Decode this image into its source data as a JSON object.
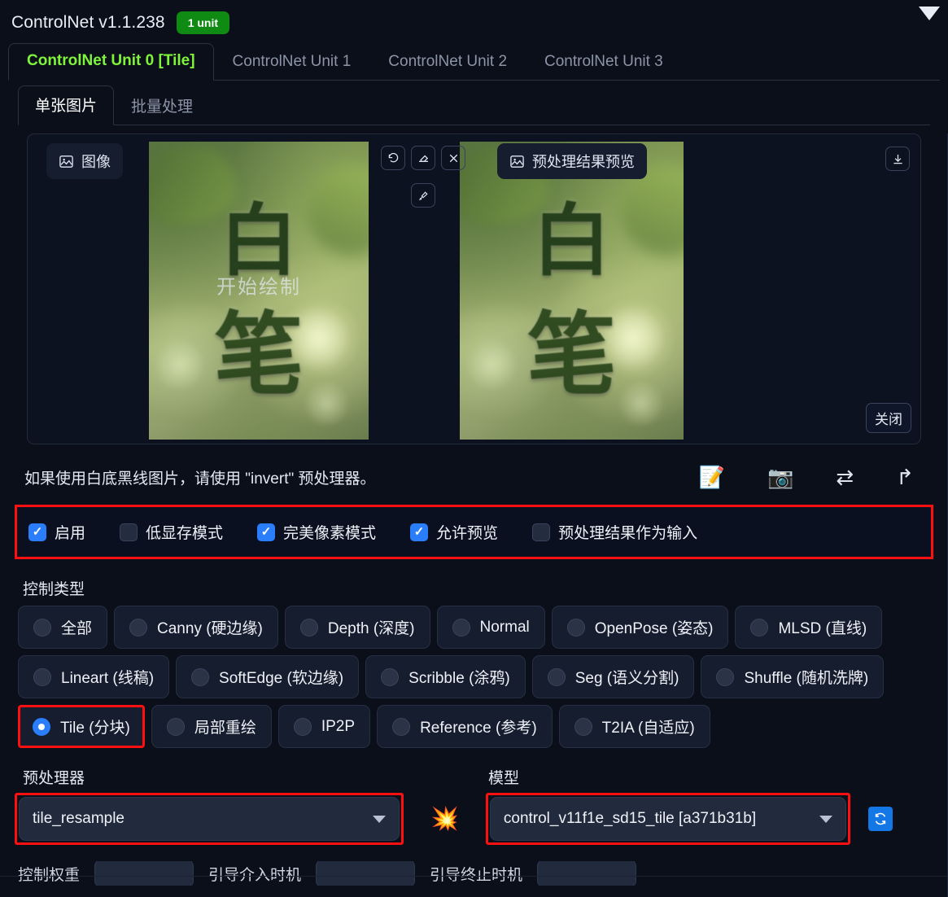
{
  "header": {
    "title": "ControlNet v1.1.238",
    "unit_badge": "1 unit",
    "collapse_icon": "caret-down-icon"
  },
  "unit_tabs": [
    {
      "label": "ControlNet Unit 0 [Tile]",
      "active": true
    },
    {
      "label": "ControlNet Unit 1",
      "active": false
    },
    {
      "label": "ControlNet Unit 2",
      "active": false
    },
    {
      "label": "ControlNet Unit 3",
      "active": false
    }
  ],
  "sub_tabs": [
    {
      "label": "单张图片",
      "active": true
    },
    {
      "label": "批量处理",
      "active": false
    }
  ],
  "image_panel": {
    "input_chip": "图像",
    "preview_chip": "预处理结果预览",
    "draw_overlay": "开始绘制",
    "close_button": "关闭",
    "tools": [
      {
        "name": "undo-icon",
        "glyph": "↺"
      },
      {
        "name": "eraser-icon",
        "glyph": "◇"
      },
      {
        "name": "clear-icon",
        "glyph": "✕"
      },
      {
        "name": "brush-icon",
        "glyph": "✎"
      }
    ],
    "download_icon": "↓",
    "image_glyph_top": "白",
    "image_glyph_bottom": "笔"
  },
  "hint": {
    "text": "如果使用白底黑线图片，请使用 \"invert\" 预处理器。",
    "icons": [
      {
        "name": "memo-icon",
        "glyph": "📝"
      },
      {
        "name": "camera-icon",
        "glyph": "📷"
      },
      {
        "name": "swap-icon",
        "glyph": "⇄"
      },
      {
        "name": "send-icon",
        "glyph": "↱"
      }
    ]
  },
  "checkboxes": [
    {
      "label": "启用",
      "checked": true
    },
    {
      "label": "低显存模式",
      "checked": false
    },
    {
      "label": "完美像素模式",
      "checked": true
    },
    {
      "label": "允许预览",
      "checked": true
    },
    {
      "label": "预处理结果作为输入",
      "checked": false
    }
  ],
  "control_type": {
    "label": "控制类型",
    "rows": [
      [
        {
          "label": "全部",
          "selected": false
        },
        {
          "label": "Canny (硬边缘)",
          "selected": false
        },
        {
          "label": "Depth (深度)",
          "selected": false
        },
        {
          "label": "Normal",
          "selected": false
        },
        {
          "label": "OpenPose (姿态)",
          "selected": false
        },
        {
          "label": "MLSD (直线)",
          "selected": false
        }
      ],
      [
        {
          "label": "Lineart (线稿)",
          "selected": false
        },
        {
          "label": "SoftEdge (软边缘)",
          "selected": false
        },
        {
          "label": "Scribble (涂鸦)",
          "selected": false
        },
        {
          "label": "Seg (语义分割)",
          "selected": false
        },
        {
          "label": "Shuffle (随机洗牌)",
          "selected": false
        }
      ],
      [
        {
          "label": "Tile (分块)",
          "selected": true
        },
        {
          "label": "局部重绘",
          "selected": false
        },
        {
          "label": "IP2P",
          "selected": false
        },
        {
          "label": "Reference (参考)",
          "selected": false
        },
        {
          "label": "T2IA (自适应)",
          "selected": false
        }
      ]
    ]
  },
  "preprocessor": {
    "label": "预处理器",
    "value": "tile_resample",
    "run_icon": "💥"
  },
  "model": {
    "label": "模型",
    "value": "control_v11f1e_sd15_tile [a371b31b]",
    "refresh_icon": "🔄"
  },
  "bottom": {
    "weight_label": "控制权重",
    "start_label": "引导介入时机",
    "end_label": "引导终止时机"
  },
  "colors": {
    "accent_green": "#7ef53a",
    "badge_green": "#0f8a12",
    "highlight_red": "#ff1010",
    "checkbox_blue": "#2a7dfb",
    "background": "#0b0f19"
  }
}
